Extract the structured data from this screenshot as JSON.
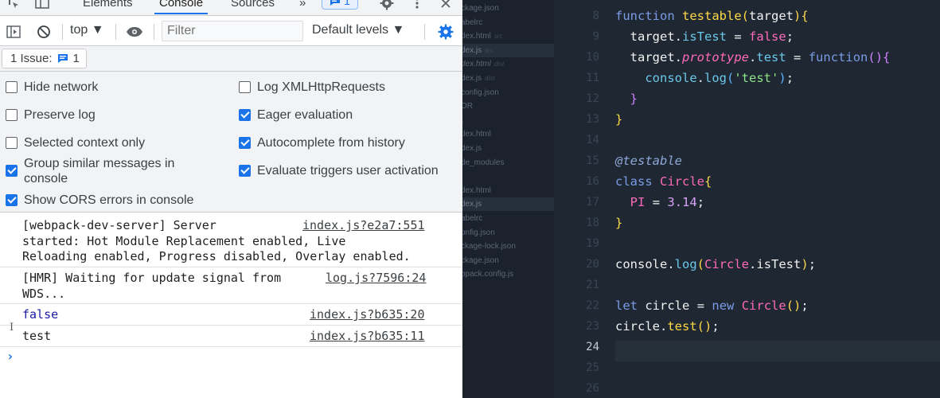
{
  "devtools": {
    "tabs": [
      "Elements",
      "Console",
      "Sources"
    ],
    "more_tabs": "»",
    "issues_count_top": "1",
    "toolbar": {
      "context": "top ▼",
      "filter_placeholder": "Filter",
      "levels": "Default levels ▼"
    },
    "issues_label": "1 Issue:",
    "issues_count": "1",
    "settings": {
      "left": [
        {
          "label": "Hide network",
          "checked": false
        },
        {
          "label": "Preserve log",
          "checked": false
        },
        {
          "label": "Selected context only",
          "checked": false
        },
        {
          "label": "Group similar messages in\nconsole",
          "checked": true
        },
        {
          "label": "Show CORS errors in console",
          "checked": true
        }
      ],
      "right": [
        {
          "label": "Log XMLHttpRequests",
          "checked": false
        },
        {
          "label": "Eager evaluation",
          "checked": true
        },
        {
          "label": "Autocomplete from history",
          "checked": true
        },
        {
          "label": "Evaluate triggers user activation",
          "checked": true
        }
      ]
    },
    "messages": [
      {
        "text": "[webpack-dev-server] Server\nstarted: Hot Module Replacement enabled, Live\nReloading enabled, Progress disabled, Overlay enabled.",
        "source": "index.js?e2a7:551"
      },
      {
        "text": "[HMR] Waiting for update signal from\nWDS...",
        "source": "log.js?7596:24"
      },
      {
        "text": "false",
        "source": "index.js?b635:20"
      },
      {
        "text": "test",
        "source": "index.js?b635:11"
      }
    ],
    "prompt": "›"
  },
  "editor": {
    "files": [
      {
        "name": "ckage.json",
        "tag": ""
      },
      {
        "name": "abelrc",
        "tag": ""
      },
      {
        "name": "dex.html",
        "tag": "src"
      },
      {
        "name": "dex.js",
        "tag": "src",
        "active": true
      },
      {
        "name": "dex.html",
        "tag": "dist",
        "italic": true
      },
      {
        "name": "dex.js",
        "tag": "dist"
      },
      {
        "name": "config.json",
        "tag": ""
      },
      {
        "name": "OR",
        "tag": ""
      },
      {
        "name": "t",
        "tag": ""
      },
      {
        "name": "dex.html",
        "tag": ""
      },
      {
        "name": "dex.js",
        "tag": ""
      },
      {
        "name": "de_modules",
        "tag": ""
      },
      {
        "name": "",
        "tag": ""
      },
      {
        "name": "dex.html",
        "tag": ""
      },
      {
        "name": "dex.js",
        "tag": "",
        "active": true
      },
      {
        "name": "abelrc",
        "tag": ""
      },
      {
        "name": "onfig.json",
        "tag": ""
      },
      {
        "name": "ckage-lock.json",
        "tag": ""
      },
      {
        "name": "ckage.json",
        "tag": ""
      },
      {
        "name": "bpack.config.js",
        "tag": ""
      }
    ],
    "line_numbers": [
      "8",
      "9",
      "10",
      "11",
      "12",
      "13",
      "14",
      "15",
      "16",
      "17",
      "18",
      "19",
      "20",
      "21",
      "22",
      "23",
      "24",
      "25",
      "26"
    ],
    "current_line": "24"
  }
}
